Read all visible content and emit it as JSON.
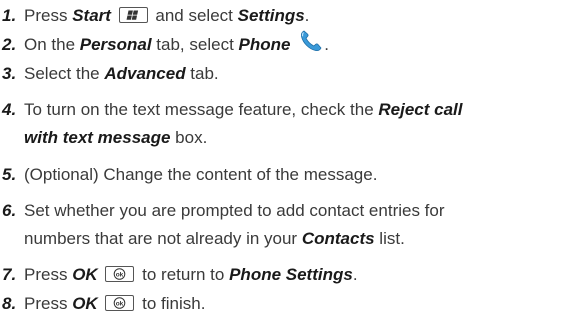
{
  "steps": [
    {
      "num": "1.",
      "parts": [
        "Press ",
        "Start",
        " and select ",
        "Settings",
        "."
      ],
      "icon": "windows-start-key-icon"
    },
    {
      "num": "2.",
      "parts": [
        "On the ",
        "Personal",
        " tab, select ",
        "Phone",
        "."
      ],
      "icon": "phone-handset-icon"
    },
    {
      "num": "3.",
      "parts": [
        "Select the ",
        "Advanced",
        " tab."
      ]
    },
    {
      "num": "4.",
      "line1": [
        "To turn on the text message feature, check the ",
        "Reject call"
      ],
      "line2": [
        "with text message",
        " box."
      ]
    },
    {
      "num": "5.",
      "parts": [
        "(Optional) Change the content of the message."
      ]
    },
    {
      "num": "6.",
      "line1": [
        "Set whether you are prompted to add contact entries for"
      ],
      "line2": [
        "numbers that are not already in your ",
        "Contacts",
        " list."
      ]
    },
    {
      "num": "7.",
      "parts": [
        "Press ",
        "OK",
        " to return to ",
        "Phone Settings",
        "."
      ],
      "icon": "ok-key-icon"
    },
    {
      "num": "8.",
      "parts": [
        "Press ",
        "OK",
        " to finish."
      ],
      "icon": "ok-key-icon"
    }
  ],
  "icons": {
    "ok_key_label": "ok"
  },
  "colors": {
    "text": "#3a3a3a",
    "phone_icon": "#3a9ad9"
  }
}
